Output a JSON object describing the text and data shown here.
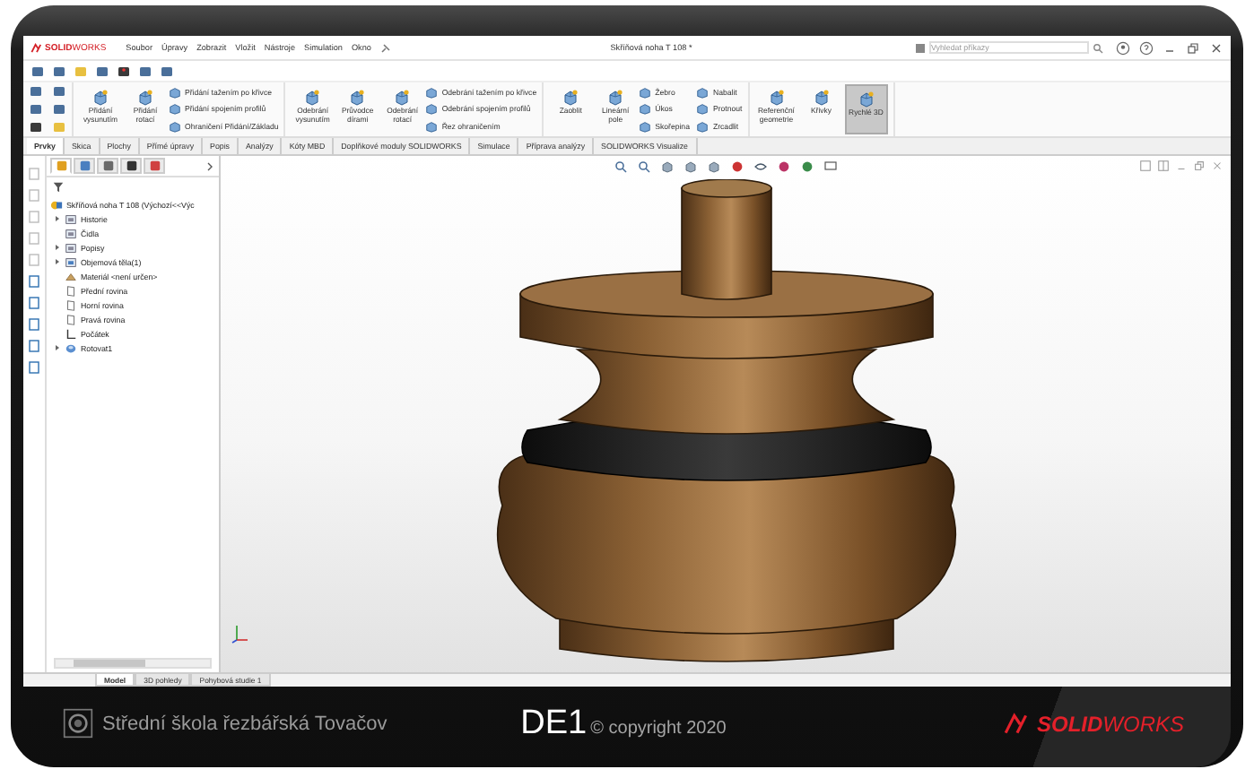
{
  "app_bar": {
    "logo": "**SOLID**WORKS",
    "menus": [
      "Soubor",
      "Úpravy",
      "Zobrazit",
      "Vložit",
      "Nástroje",
      "Simulation",
      "Okno"
    ],
    "title": "Skříňová noha T 108 *",
    "search": {
      "placeholder": "Vyhledat příkazy"
    }
  },
  "ribbon": {
    "groups": [
      {
        "large": [
          {
            "label": "Přidání vysunutím",
            "selected": false
          },
          {
            "label": "Přidání rotací",
            "selected": false
          }
        ],
        "small": [
          "Přidání tažením po křivce",
          "Přidání spojením profilů",
          "Ohraničení Přidání/Základu"
        ]
      },
      {
        "large": [
          {
            "label": "Odebrání vysunutím",
            "selected": false
          },
          {
            "label": "Průvodce dírami",
            "selected": false
          },
          {
            "label": "Odebrání rotací",
            "selected": false
          }
        ],
        "small": [
          "Odebrání tažením po křivce",
          "Odebrání spojením profilů",
          "Řez ohraničením"
        ]
      },
      {
        "large": [
          {
            "label": "Zaoblit",
            "selected": false
          },
          {
            "label": "Lineární pole",
            "selected": false
          }
        ],
        "small": [
          "Žebro",
          "Úkos",
          "Skořepina",
          "Nabalit",
          "Protnout",
          "Zrcadlit"
        ]
      },
      {
        "large": [
          {
            "label": "Referenční geometrie",
            "selected": false
          },
          {
            "label": "Křivky",
            "selected": false
          },
          {
            "label": "Rychlé 3D",
            "selected": true
          }
        ]
      }
    ]
  },
  "tabs": [
    {
      "label": "Prvky",
      "selected": true
    },
    {
      "label": "Skica",
      "selected": false
    },
    {
      "label": "Plochy",
      "selected": false
    },
    {
      "label": "Přímé úpravy",
      "selected": false
    },
    {
      "label": "Popis",
      "selected": false
    },
    {
      "label": "Analýzy",
      "selected": false
    },
    {
      "label": "Kóty MBD",
      "selected": false
    },
    {
      "label": "Doplňkové moduly SOLIDWORKS",
      "selected": false
    },
    {
      "label": "Simulace",
      "selected": false
    },
    {
      "label": "Příprava analýzy",
      "selected": false
    },
    {
      "label": "SOLIDWORKS Visualize",
      "selected": false
    }
  ],
  "tree": {
    "tabs": [
      {
        "kind": "features",
        "selected": true
      },
      {
        "kind": "properties",
        "selected": false
      },
      {
        "kind": "configurations",
        "selected": false
      },
      {
        "kind": "dimxpert",
        "selected": false
      },
      {
        "kind": "display",
        "selected": false
      }
    ],
    "root": "Skříňová noha T 108  (Výchozí<<Výc",
    "items": [
      {
        "kind": "history",
        "label": "Historie",
        "expandable": true
      },
      {
        "kind": "sensors",
        "label": "Čidla",
        "expandable": false
      },
      {
        "kind": "annotations",
        "label": "Popisy",
        "expandable": true
      },
      {
        "kind": "bodies",
        "label": "Objemová těla(1)",
        "expandable": true
      },
      {
        "kind": "material",
        "label": "Materiál <není určen>",
        "expandable": false
      },
      {
        "kind": "plane",
        "label": "Přední rovina",
        "expandable": false
      },
      {
        "kind": "plane",
        "label": "Horní rovina",
        "expandable": false
      },
      {
        "kind": "plane",
        "label": "Pravá rovina",
        "expandable": false
      },
      {
        "kind": "origin",
        "label": "Počátek",
        "expandable": false
      },
      {
        "kind": "feature",
        "label": "Rotovat1",
        "expandable": true
      }
    ]
  },
  "bottom_tabs": [
    {
      "label": "Model",
      "selected": true
    },
    {
      "label": "3D pohledy",
      "selected": false
    },
    {
      "label": "Pohybová studie 1",
      "selected": false
    }
  ],
  "footer": {
    "school": "Střední škola řezbářská Tovačov",
    "code": "DE1",
    "copyright": "© copyright 2020",
    "logo": "**SOLID**WORKS"
  }
}
